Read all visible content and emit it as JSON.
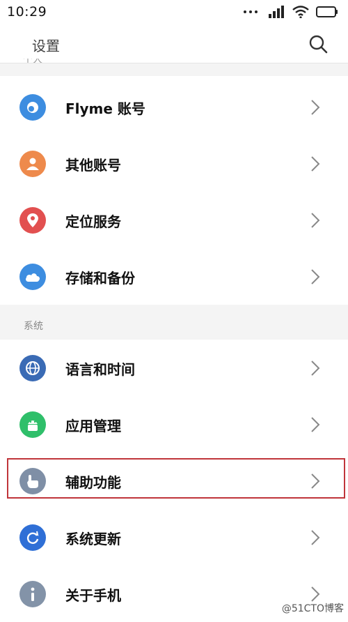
{
  "status_bar": {
    "time": "10:29"
  },
  "title_bar": {
    "title": "设置"
  },
  "sections": [
    {
      "label": "个人"
    },
    {
      "label": "系统"
    }
  ],
  "rows": [
    {
      "label": "Flyme 账号",
      "icon": "flyme-icon",
      "color": "#3d8de0"
    },
    {
      "label": "其他账号",
      "icon": "person-icon",
      "color": "#ee8a4c"
    },
    {
      "label": "定位服务",
      "icon": "location-pin-icon",
      "color": "#e25050"
    },
    {
      "label": "存储和备份",
      "icon": "cloud-icon",
      "color": "#3d8de0"
    },
    {
      "label": "语言和时间",
      "icon": "globe-icon",
      "color": "#3a6bb5"
    },
    {
      "label": "应用管理",
      "icon": "android-icon",
      "color": "#2fbf6a"
    },
    {
      "label": "辅助功能",
      "icon": "hand-pointer-icon",
      "color": "#7f8fa6"
    },
    {
      "label": "系统更新",
      "icon": "refresh-icon",
      "color": "#2f6fd6"
    },
    {
      "label": "关于手机",
      "icon": "info-icon",
      "color": "#8393a8"
    }
  ],
  "watermark": "@51CTO博客",
  "colors": {
    "highlight": "#c0353a",
    "background": "#f4f4f4"
  }
}
